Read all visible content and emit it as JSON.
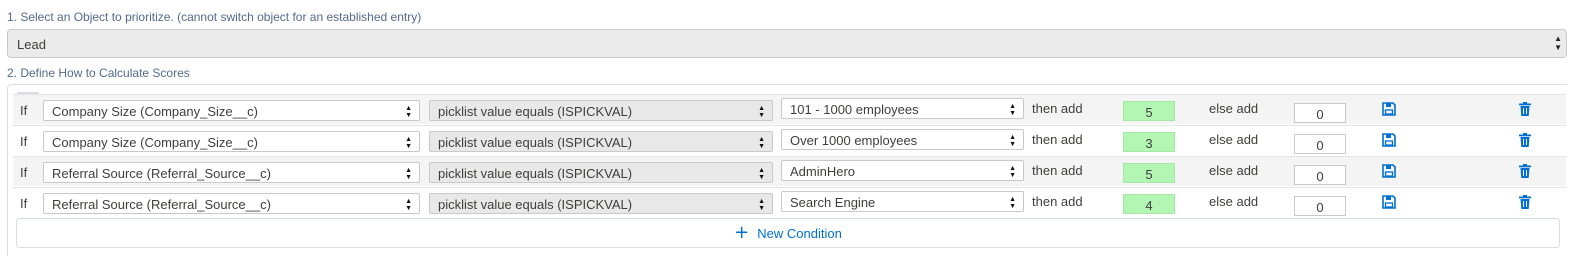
{
  "steps": {
    "step1_label": "1. Select an Object to prioritize. (cannot switch object for an established entry)",
    "step2_label": "2. Define How to Calculate Scores"
  },
  "object_select": {
    "value": "Lead"
  },
  "conditions": [
    {
      "if": "If",
      "field": "Company Size (Company_Size__c)",
      "operator": "picklist value equals (ISPICKVAL)",
      "value": "101 - 1000 employees",
      "then_label": "then add",
      "then_value": "5",
      "else_label": "else add",
      "else_value": "0"
    },
    {
      "if": "If",
      "field": "Company Size (Company_Size__c)",
      "operator": "picklist value equals (ISPICKVAL)",
      "value": "Over 1000 employees",
      "then_label": "then add",
      "then_value": "3",
      "else_label": "else add",
      "else_value": "0"
    },
    {
      "if": "If",
      "field": "Referral Source (Referral_Source__c)",
      "operator": "picklist value equals (ISPICKVAL)",
      "value": "AdminHero",
      "then_label": "then add",
      "then_value": "5",
      "else_label": "else add",
      "else_value": "0"
    },
    {
      "if": "If",
      "field": "Referral Source (Referral_Source__c)",
      "operator": "picklist value equals (ISPICKVAL)",
      "value": "Search Engine",
      "then_label": "then add",
      "then_value": "4",
      "else_label": "else add",
      "else_value": "0"
    }
  ],
  "new_condition": {
    "label": "New Condition",
    "icon": "plus-icon"
  },
  "icons": {
    "save": "save-icon",
    "delete": "trash-icon"
  },
  "colors": {
    "accent": "#0070d2",
    "then_value_bg": "#b3f5b3"
  }
}
